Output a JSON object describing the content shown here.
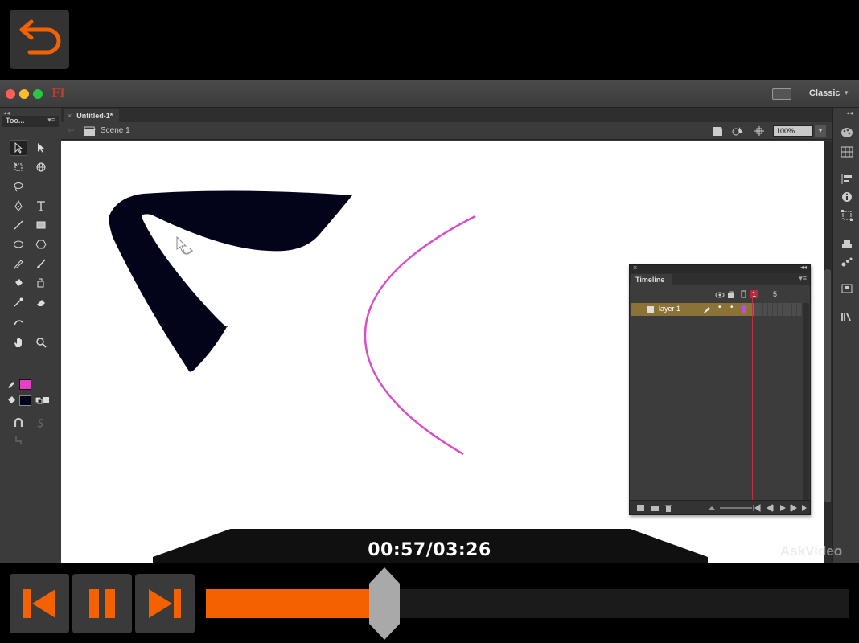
{
  "player": {
    "timecode": "00:57/03:26",
    "elapsed": "00:57",
    "duration": "03:26",
    "progress_fraction": 0.277,
    "brand": "AskVideo",
    "accent_color": "#f46100",
    "icons": {
      "back": "undo-arrow-icon",
      "prev": "skip-previous-icon",
      "pause": "pause-icon",
      "next": "skip-next-icon"
    }
  },
  "app": {
    "logo": "Fl",
    "workspace": "Classic",
    "document_tab": "Untitled-1*",
    "scene": "Scene 1",
    "zoom": "100%",
    "tools_panel_title": "Too...",
    "stroke_color": "#e53fc3",
    "fill_color": "#03031a"
  },
  "timeline": {
    "tab": "Timeline",
    "frame_labels": [
      "1",
      "5"
    ],
    "current_frame": "1",
    "layers": [
      {
        "name": "layer 1"
      }
    ]
  }
}
